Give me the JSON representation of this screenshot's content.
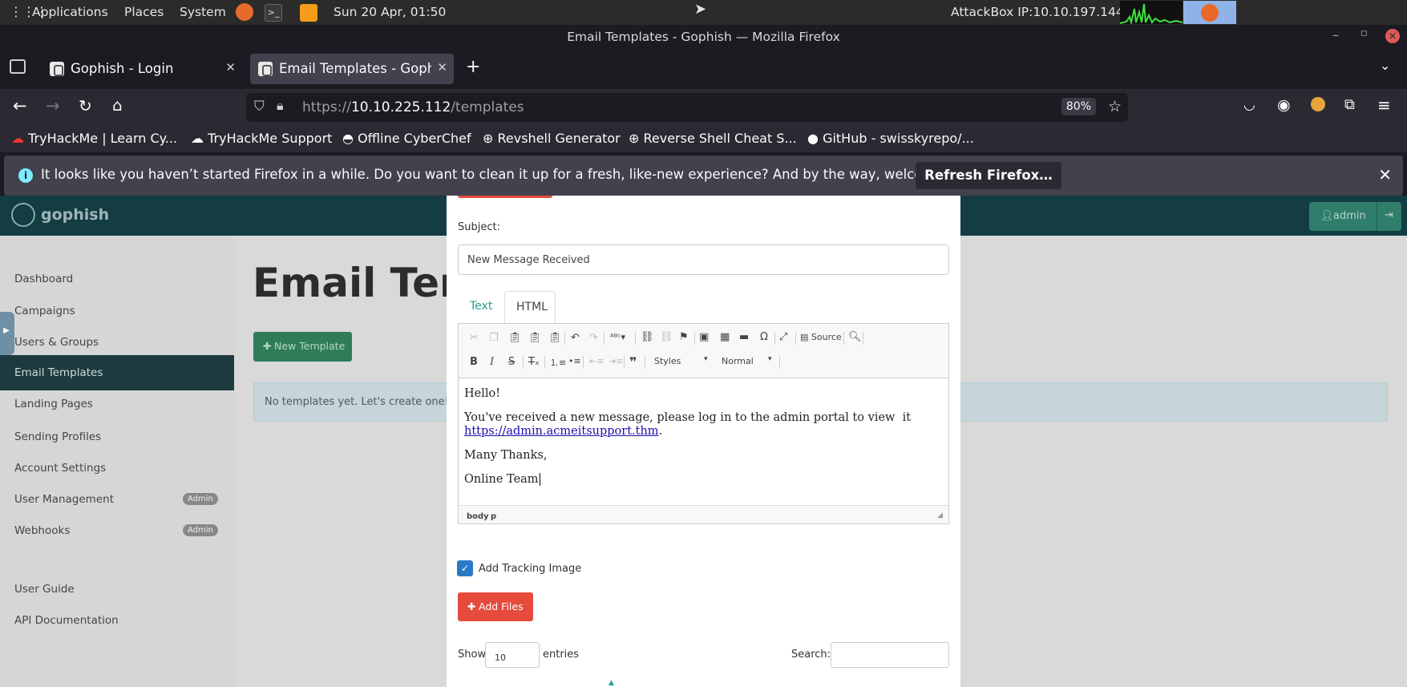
{
  "os_bar": {
    "applications": "Applications",
    "places": "Places",
    "system": "System",
    "datetime": "Sun 20 Apr, 01:50",
    "attackbox_ip": "AttackBox IP:10.10.197.144"
  },
  "window_title": "Email Templates - Gophish — Mozilla Firefox",
  "tabs": [
    {
      "label": "Gophish - Login"
    },
    {
      "label": "Email Templates - Gophish"
    }
  ],
  "url": {
    "prefix": "https://",
    "host": "10.10.225.112",
    "path": "/templates"
  },
  "zoom": "80%",
  "bookmarks": [
    "TryHackMe | Learn Cy...",
    "TryHackMe Support",
    "Offline CyberChef",
    "Revshell Generator",
    "Reverse Shell Cheat S...",
    "GitHub - swisskyrepo/..."
  ],
  "notification": {
    "message": "It looks like you haven’t started Firefox in a while. Do you want to clean it up for a fresh, like-new experience? And by the way, welcome back!",
    "button": "Refresh Firefox…"
  },
  "gophish": {
    "brand": "gophish",
    "admin_label": "admin",
    "sidebar": [
      {
        "label": "Dashboard"
      },
      {
        "label": "Campaigns"
      },
      {
        "label": "Users & Groups"
      },
      {
        "label": "Email Templates"
      },
      {
        "label": "Landing Pages"
      },
      {
        "label": "Sending Profiles"
      },
      {
        "label": "Account Settings"
      },
      {
        "label": "User Management"
      },
      {
        "label": "Webhooks"
      },
      {
        "label": "User Guide"
      },
      {
        "label": "API Documentation"
      }
    ],
    "admin_badge": "Admin",
    "page_title": "Email Templates",
    "new_template": "New Template",
    "empty_message": "No templates yet. Let's create one!"
  },
  "modal": {
    "subject_label": "Subject:",
    "subject_value": "New Message Received",
    "tab_text": "Text",
    "tab_html": "HTML",
    "source_label": "Source",
    "styles_label": "Styles",
    "format_label": "Normal",
    "body": {
      "line1": "Hello!",
      "line2": "You've received a new message, please log in to the admin portal to view  it",
      "link": "https://admin.acmeitsupport.thm",
      "line3": "Many Thanks,",
      "line4": "Online Team"
    },
    "path_body": "body",
    "path_p": "p",
    "tracking_label": "Add Tracking Image",
    "add_files": "Add Files",
    "show_label": "Show",
    "show_value": "10",
    "entries_label": "entries",
    "search_label": "Search:"
  }
}
